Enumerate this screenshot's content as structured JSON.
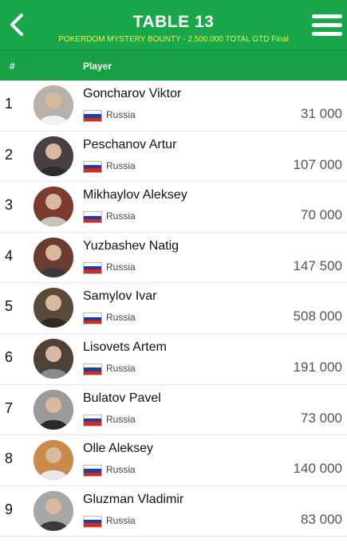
{
  "header": {
    "title": "TABLE 13",
    "subtitle": "POKERDOM MYSTERY BOUNTY - 2.500.000 TOTAL GTD Final"
  },
  "columns": {
    "rank": "#",
    "player": "Player"
  },
  "players": [
    {
      "rank": "1",
      "name": "Goncharov Viktor",
      "country": "Russia",
      "chips": "31 000",
      "avatar_bg": "#b9b1a7",
      "avatar_fg": "#f2f2f2"
    },
    {
      "rank": "2",
      "name": "Peschanov Artur",
      "country": "Russia",
      "chips": "107 000",
      "avatar_bg": "#4a3f43",
      "avatar_fg": "#2b2b2b"
    },
    {
      "rank": "3",
      "name": "Mikhaylov Aleksey",
      "country": "Russia",
      "chips": "70 000",
      "avatar_bg": "#7d3a2e",
      "avatar_fg": "#c7c2ba"
    },
    {
      "rank": "4",
      "name": "Yuzbashev Natig",
      "country": "Russia",
      "chips": "147 500",
      "avatar_bg": "#6b3a33",
      "avatar_fg": "#3a3a3a"
    },
    {
      "rank": "5",
      "name": "Samylov Ivar",
      "country": "Russia",
      "chips": "508 000",
      "avatar_bg": "#5a4a3a",
      "avatar_fg": "#2f2a26"
    },
    {
      "rank": "6",
      "name": "Lisovets Artem",
      "country": "Russia",
      "chips": "191 000",
      "avatar_bg": "#4d4138",
      "avatar_fg": "#8a8a8a"
    },
    {
      "rank": "7",
      "name": "Bulatov Pavel",
      "country": "Russia",
      "chips": "73 000",
      "avatar_bg": "#9a9a9a",
      "avatar_fg": "#2a2a2a"
    },
    {
      "rank": "8",
      "name": "Olle Aleksey",
      "country": "Russia",
      "chips": "140 000",
      "avatar_bg": "#c98a4a",
      "avatar_fg": "#e8e8e8"
    },
    {
      "rank": "9",
      "name": "Gluzman Vladimir",
      "country": "Russia",
      "chips": "83 000",
      "avatar_bg": "#a7a7a7",
      "avatar_fg": "#3a3a3a"
    }
  ],
  "colors": {
    "header_green": "#1aa64a",
    "subtitle_yellow": "#e8f24a",
    "flag_white": "#ffffff",
    "flag_blue": "#1f3fa0",
    "flag_red": "#d52b1e"
  },
  "icons": {
    "back": "chevron-left-icon",
    "menu": "hamburger-menu-icon"
  }
}
